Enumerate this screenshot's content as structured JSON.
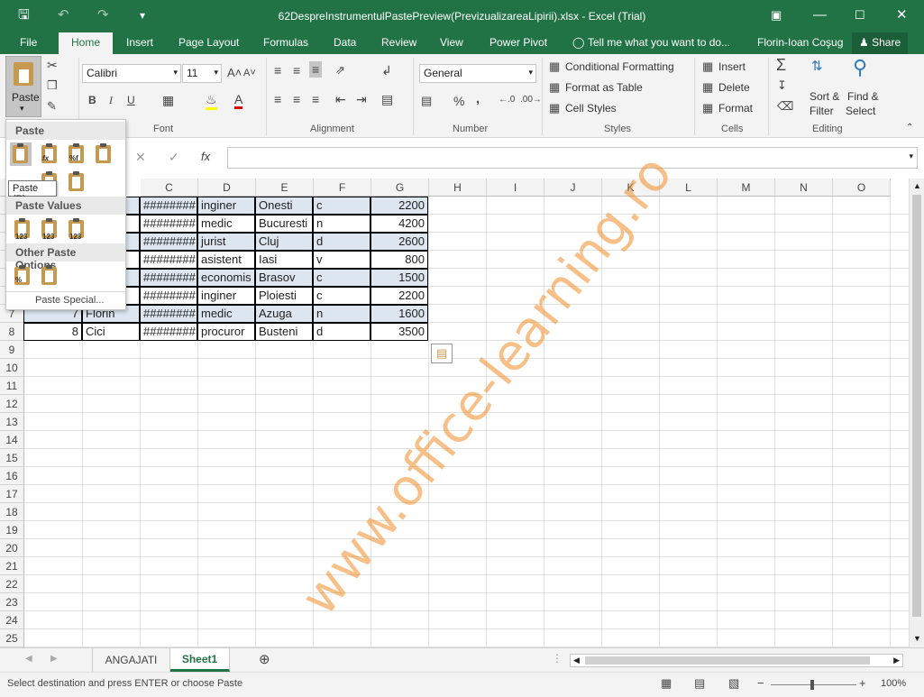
{
  "window": {
    "title": "62DespreInstrumentulPastePreview(PrevizualizareaLipirii).xlsx - Excel (Trial)"
  },
  "menu_tabs": [
    {
      "label": "File"
    },
    {
      "label": "Home"
    },
    {
      "label": "Insert"
    },
    {
      "label": "Page Layout"
    },
    {
      "label": "Formulas"
    },
    {
      "label": "Data"
    },
    {
      "label": "Review"
    },
    {
      "label": "View"
    },
    {
      "label": "Power Pivot"
    }
  ],
  "tell_me": "Tell me what you want to do...",
  "user_name": "Florin-Ioan Coşug",
  "share_label": "Share",
  "ribbon": {
    "paste_label": "Paste",
    "font_name": "Calibri",
    "font_size": "11",
    "number_format": "General",
    "conditional_formatting": "Conditional Formatting",
    "format_as_table": "Format as Table",
    "cell_styles": "Cell Styles",
    "insert": "Insert",
    "delete": "Delete",
    "format": "Format",
    "sort_filter_1": "Sort &",
    "sort_filter_2": "Filter",
    "find_select_1": "Find &",
    "find_select_2": "Select",
    "groups": {
      "font": "Font",
      "alignment": "Alignment",
      "number": "Number",
      "styles": "Styles",
      "cells": "Cells",
      "editing": "Editing"
    }
  },
  "paste_menu": {
    "header_paste": "Paste",
    "tooltip": "Paste (P)",
    "header_values": "Paste Values",
    "header_other": "Other Paste Options",
    "paste_special": "Paste Special...",
    "value_badge": "123"
  },
  "columns": [
    "C",
    "D",
    "E",
    "F",
    "G",
    "H",
    "I",
    "J",
    "K",
    "L",
    "M",
    "N",
    "O"
  ],
  "row_numbers": [
    "7",
    "8",
    "9",
    "10",
    "11",
    "12",
    "13",
    "14",
    "15",
    "16",
    "17",
    "18",
    "19",
    "20",
    "21",
    "22",
    "23",
    "24",
    "25"
  ],
  "data_rows": [
    {
      "a": "",
      "b": "",
      "c": "########",
      "d": "inginer",
      "e": "Onesti",
      "f": "c",
      "g": "2200"
    },
    {
      "a": "",
      "b": "",
      "c": "########",
      "d": "medic",
      "e": "Bucuresti",
      "f": "n",
      "g": "4200"
    },
    {
      "a": "",
      "b": "",
      "c": "########",
      "d": "jurist",
      "e": "Cluj",
      "f": "d",
      "g": "2600"
    },
    {
      "a": "",
      "b": "",
      "c": "########",
      "d": "asistent",
      "e": "Iasi",
      "f": "v",
      "g": "800"
    },
    {
      "a": "",
      "b": "",
      "c": "########",
      "d": "economis",
      "e": "Brasov",
      "f": "c",
      "g": "1500"
    },
    {
      "a": "",
      "b": "",
      "c": "########",
      "d": "inginer",
      "e": "Ploiesti",
      "f": "c",
      "g": "2200"
    },
    {
      "a": "7",
      "b": "Florin",
      "c": "########",
      "d": "medic",
      "e": "Azuga",
      "f": "n",
      "g": "1600"
    },
    {
      "a": "8",
      "b": "Cici",
      "c": "########",
      "d": "procuror",
      "e": "Busteni",
      "f": "d",
      "g": "3500"
    }
  ],
  "sheets": [
    {
      "label": "ANGAJATI"
    },
    {
      "label": "Sheet1"
    }
  ],
  "status_text": "Select destination and press ENTER or choose Paste",
  "zoom": "100%",
  "watermark": "www.office-learning.ro",
  "colors": {
    "accent": "#217346",
    "selection": "#dce6f1",
    "watermark": "#f28c28"
  }
}
